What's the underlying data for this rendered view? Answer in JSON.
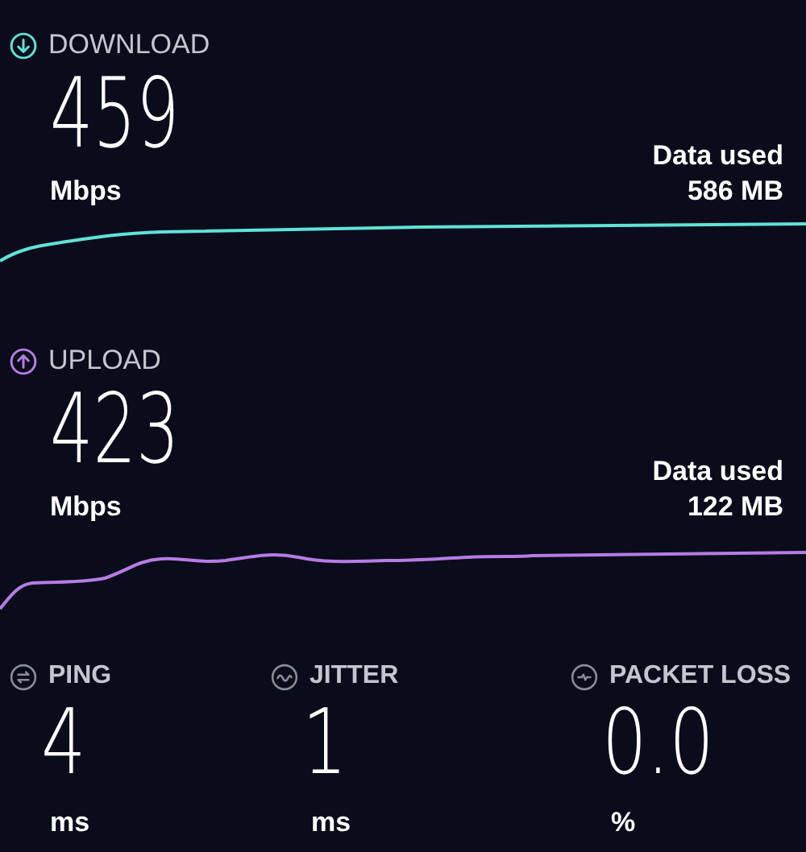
{
  "tests": [
    {
      "kind": "download",
      "label": "DOWNLOAD",
      "value": "459",
      "unit": "Mbps",
      "data_label": "Data used",
      "data_value": "586 MB",
      "color": "#5fe3d6"
    },
    {
      "kind": "upload",
      "label": "UPLOAD",
      "value": "423",
      "unit": "Mbps",
      "data_label": "Data used",
      "data_value": "122 MB",
      "color": "#b67ce6"
    }
  ],
  "metrics": [
    {
      "kind": "ping",
      "label": "PING",
      "value": "4",
      "unit": "ms"
    },
    {
      "kind": "jitter",
      "label": "JITTER",
      "value": "1",
      "unit": "ms"
    },
    {
      "kind": "packet_loss",
      "label": "PACKET LOSS",
      "value": "0.0",
      "unit": "%"
    }
  ]
}
